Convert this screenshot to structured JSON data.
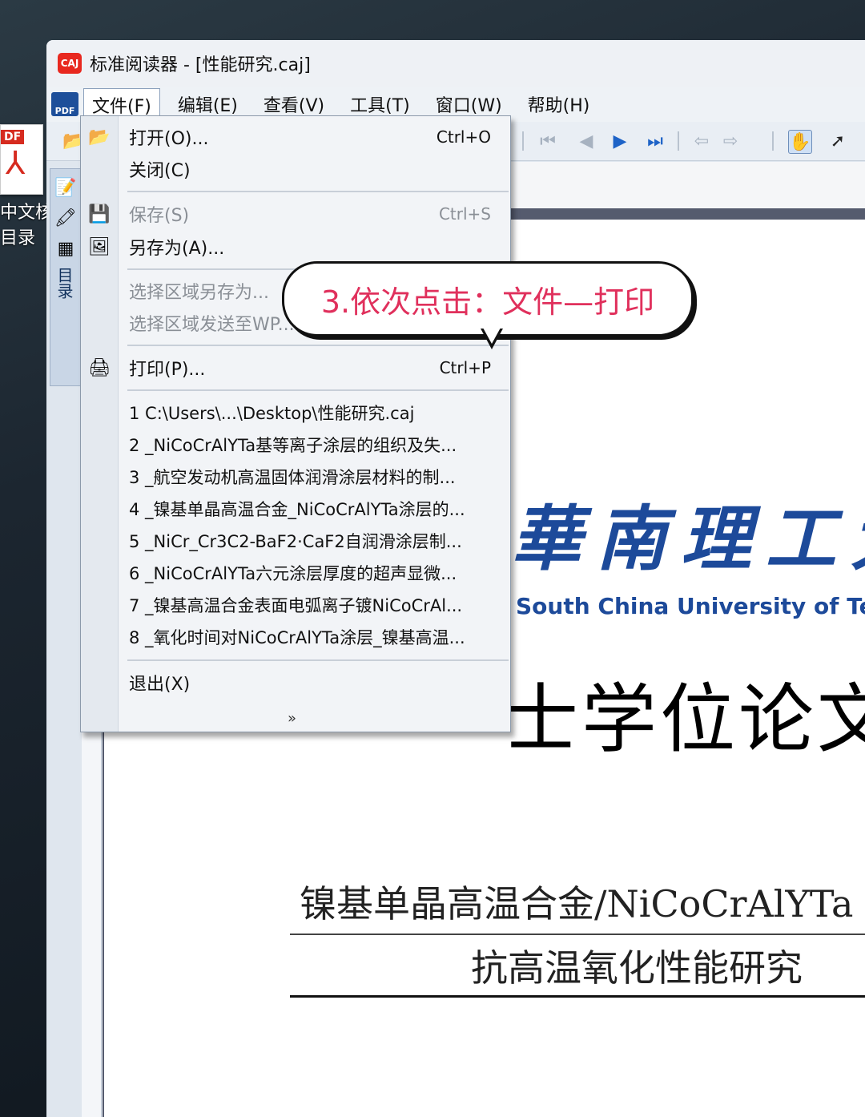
{
  "desktop": {
    "pdf_tag": "DF",
    "label_line1": "中文核",
    "label_line2": "目录"
  },
  "window": {
    "title": "标准阅读器 - [性能研究.caj]",
    "app_icon_text": "CAJ"
  },
  "menubar": {
    "logo_text": "PDF",
    "items": [
      "文件(F)",
      "编辑(E)",
      "查看(V)",
      "工具(T)",
      "窗口(W)",
      "帮助(H)"
    ]
  },
  "sidebar": {
    "toc_label": "目录"
  },
  "file_menu": {
    "open": {
      "label": "打开(O)...",
      "shortcut": "Ctrl+O"
    },
    "close": {
      "label": "关闭(C)"
    },
    "save": {
      "label": "保存(S)",
      "shortcut": "Ctrl+S"
    },
    "save_as": {
      "label": "另存为(A)..."
    },
    "region_save_as": {
      "label": "选择区域另存为..."
    },
    "region_send": {
      "label": "选择区域发送至WP..."
    },
    "print": {
      "label": "打印(P)...",
      "shortcut": "Ctrl+P"
    },
    "recent": [
      "1 C:\\Users\\...\\Desktop\\性能研究.caj",
      "2 _NiCoCrAlYTa基等离子涂层的组织及失...",
      "3 _航空发动机高温固体润滑涂层材料的制...",
      "4 _镍基单晶高温合金_NiCoCrAlYTa涂层的...",
      "5 _NiCr_Cr3C2-BaF2·CaF2自润滑涂层制...",
      "6 _NiCoCrAlYTa六元涂层厚度的超声显微...",
      "7 _镍基高温合金表面电弧离子镀NiCoCrAl...",
      "8 _氧化时间对NiCoCrAlYTa涂层_镍基高温..."
    ],
    "exit": {
      "label": "退出(X)"
    },
    "more": "»"
  },
  "callout": {
    "text": "3.依次点击：文件—打印"
  },
  "document": {
    "logo_cn": "華南理工大",
    "logo_en": "South China University of Tec",
    "degree": "士学位论文",
    "title_line1": "镍基单晶高温合金/NiCoCrAlYTa",
    "title_line2": "抗高温氧化性能研究"
  }
}
